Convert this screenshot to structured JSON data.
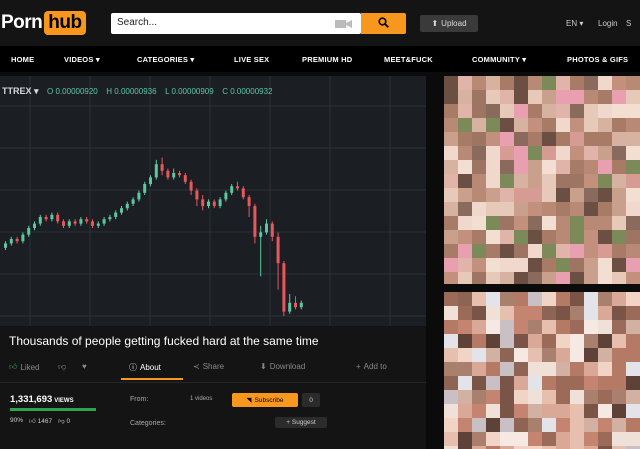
{
  "header": {
    "logo_left": "Porn",
    "logo_right": "hub",
    "search_placeholder": "Search...",
    "upload_label": "Upload",
    "lang_label": "EN",
    "login_label": "Login",
    "login_extra": "S"
  },
  "nav": [
    {
      "label": "HOME"
    },
    {
      "label": "VIDEOS ▾"
    },
    {
      "label": "CATEGORIES ▾"
    },
    {
      "label": "LIVE SEX"
    },
    {
      "label": "PREMIUM HD"
    },
    {
      "label": "MEET&FUCK"
    },
    {
      "label": "COMMUNITY ▾"
    },
    {
      "label": "PHOTOS & GIFS"
    }
  ],
  "ticker": {
    "symbol": "TTREX ▾",
    "open": "O 0.00000920",
    "high": "H 0.00000936",
    "low": "L 0.00000909",
    "close": "C 0.00000932"
  },
  "chart_data": {
    "type": "candlestick",
    "colors": {
      "up": "#5dc8a0",
      "down": "#e8575b"
    },
    "candles": [
      [
        0.31,
        0.33,
        0.3,
        0.34
      ],
      [
        0.33,
        0.35,
        0.32,
        0.36
      ],
      [
        0.35,
        0.34,
        0.33,
        0.36
      ],
      [
        0.34,
        0.37,
        0.33,
        0.38
      ],
      [
        0.37,
        0.4,
        0.36,
        0.41
      ],
      [
        0.4,
        0.42,
        0.39,
        0.43
      ],
      [
        0.42,
        0.45,
        0.41,
        0.46
      ],
      [
        0.45,
        0.44,
        0.43,
        0.46
      ],
      [
        0.44,
        0.46,
        0.43,
        0.47
      ],
      [
        0.46,
        0.43,
        0.42,
        0.47
      ],
      [
        0.43,
        0.41,
        0.4,
        0.44
      ],
      [
        0.41,
        0.43,
        0.4,
        0.44
      ],
      [
        0.43,
        0.42,
        0.41,
        0.44
      ],
      [
        0.42,
        0.44,
        0.41,
        0.45
      ],
      [
        0.44,
        0.43,
        0.42,
        0.45
      ],
      [
        0.43,
        0.41,
        0.4,
        0.44
      ],
      [
        0.41,
        0.42,
        0.4,
        0.43
      ],
      [
        0.42,
        0.44,
        0.41,
        0.45
      ],
      [
        0.44,
        0.45,
        0.43,
        0.46
      ],
      [
        0.45,
        0.47,
        0.44,
        0.48
      ],
      [
        0.47,
        0.49,
        0.46,
        0.5
      ],
      [
        0.49,
        0.51,
        0.48,
        0.52
      ],
      [
        0.51,
        0.53,
        0.5,
        0.54
      ],
      [
        0.53,
        0.56,
        0.52,
        0.57
      ],
      [
        0.56,
        0.6,
        0.55,
        0.61
      ],
      [
        0.6,
        0.63,
        0.59,
        0.64
      ],
      [
        0.63,
        0.69,
        0.62,
        0.71
      ],
      [
        0.69,
        0.66,
        0.64,
        0.72
      ],
      [
        0.66,
        0.63,
        0.62,
        0.67
      ],
      [
        0.63,
        0.65,
        0.62,
        0.67
      ],
      [
        0.65,
        0.64,
        0.63,
        0.66
      ],
      [
        0.64,
        0.61,
        0.6,
        0.65
      ],
      [
        0.61,
        0.57,
        0.55,
        0.62
      ],
      [
        0.57,
        0.53,
        0.5,
        0.58
      ],
      [
        0.53,
        0.5,
        0.48,
        0.55
      ],
      [
        0.5,
        0.52,
        0.49,
        0.53
      ],
      [
        0.52,
        0.5,
        0.49,
        0.53
      ],
      [
        0.5,
        0.53,
        0.49,
        0.54
      ],
      [
        0.53,
        0.56,
        0.52,
        0.57
      ],
      [
        0.56,
        0.59,
        0.55,
        0.6
      ],
      [
        0.59,
        0.58,
        0.57,
        0.61
      ],
      [
        0.58,
        0.54,
        0.53,
        0.59
      ],
      [
        0.54,
        0.5,
        0.45,
        0.55
      ],
      [
        0.5,
        0.36,
        0.33,
        0.51
      ],
      [
        0.36,
        0.38,
        0.18,
        0.41
      ],
      [
        0.38,
        0.42,
        0.37,
        0.44
      ],
      [
        0.42,
        0.36,
        0.34,
        0.43
      ],
      [
        0.36,
        0.24,
        0.12,
        0.38
      ],
      [
        0.24,
        0.02,
        0.0,
        0.25
      ],
      [
        0.02,
        0.06,
        0.01,
        0.1
      ],
      [
        0.06,
        0.04,
        0.03,
        0.09
      ],
      [
        0.04,
        0.06,
        0.03,
        0.07
      ]
    ],
    "title": "",
    "xlabel": "",
    "ylabel": "",
    "grid": true
  },
  "video": {
    "title": "Thousands of people getting fucked hard at the same time",
    "liked": "Liked",
    "about": "About",
    "share": "Share",
    "download": "Download",
    "add_to": "Add to",
    "views": "1,331,693",
    "views_label": "VIEWS",
    "rating": "90%",
    "likes": "1467",
    "dislikes": "0",
    "from_label": "From:",
    "from_value": "1 videos",
    "subscribe": "Subscribe",
    "sub_count": "0",
    "categories_label": "Categories:",
    "suggest": "+ Suggest"
  }
}
